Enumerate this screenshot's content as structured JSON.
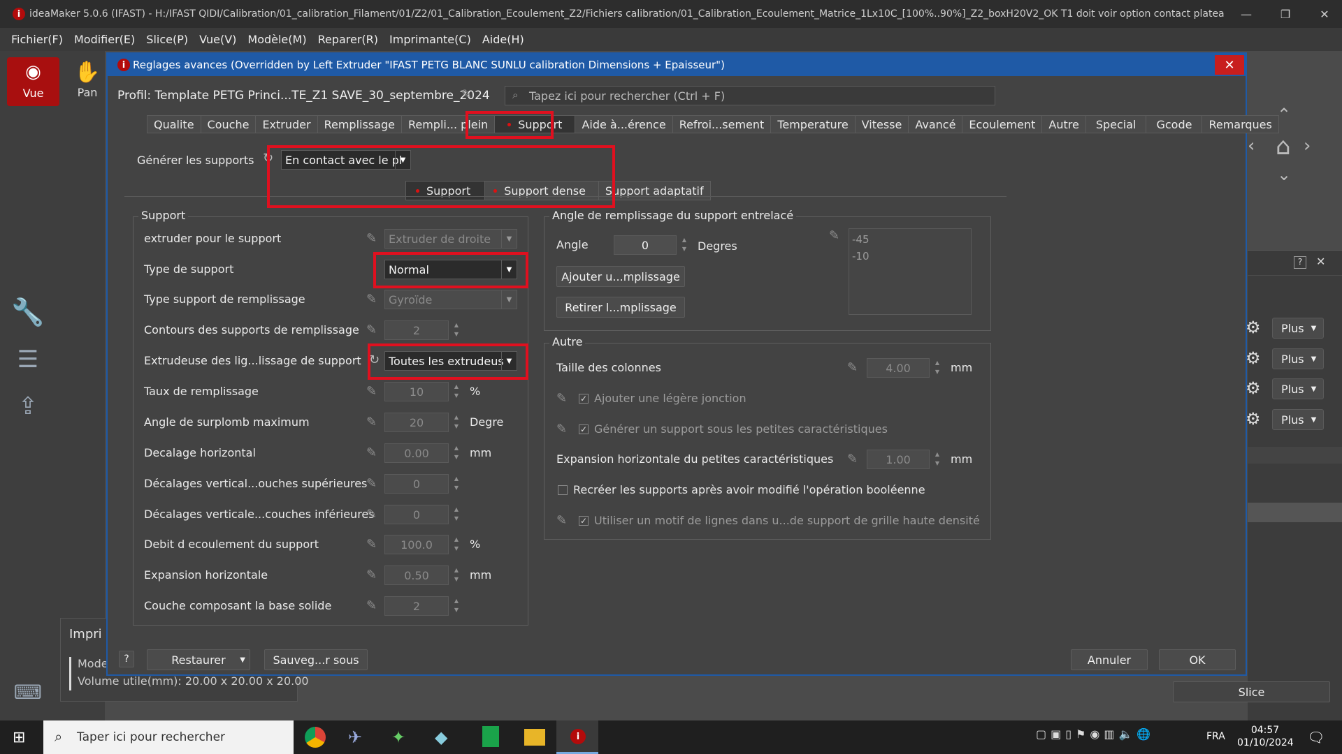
{
  "window": {
    "title": "ideaMaker 5.0.6 (IFAST) - H:/IFAST QIDI/Calibration/01_calibration_Filament/01/Z2/01_Calibration_Ecoulement_Z2/Fichiers calibration/01_Calibration_Ecoulement_Matrice_1Lx10C_[100%..90%]_Z2_boxH20V2_OK T1 doit voir option contact plateau.idea *"
  },
  "menu": [
    "Fichier(F)",
    "Modifier(E)",
    "Slice(P)",
    "Vue(V)",
    "Modèle(M)",
    "Reparer(R)",
    "Imprimante(C)",
    "Aide(H)"
  ],
  "toolbar": {
    "vue": "Vue",
    "pan": "Pan"
  },
  "printer_panel": {
    "title": "Impri",
    "model_label": "Mode",
    "volume": "Volume utile(mm): 20.00 x 20.00 x 20.00"
  },
  "right_panel": {
    "more_label": "Plus",
    "slice": "Slice"
  },
  "dialog": {
    "title": "Reglages avances (Overridden by Left Extruder \"IFAST PETG BLANC SUNLU calibration Dimensions + Epaisseur\")",
    "profile": "Profil: Template PETG Princi...TE_Z1 SAVE_30_septembre_2024",
    "search_placeholder": "Tapez ici pour rechercher (Ctrl + F)",
    "tabs": [
      "Qualite",
      "Couche",
      "Extruder",
      "Remplissage",
      "Rempli... plein",
      "Support",
      "Aide à...érence",
      "Refroi...sement",
      "Temperature",
      "Vitesse",
      "Avancé",
      "Ecoulement",
      "Autre",
      "Special",
      "Gcode",
      "Remarques"
    ],
    "generate_label": "Générer les supports",
    "generate_value": "En contact avec le pl",
    "subtabs": [
      "Support",
      "Support dense",
      "Support adaptatif"
    ],
    "support_group": {
      "title": "Support",
      "rows": [
        {
          "label": "extruder pour le support",
          "value": "Extruder de droite"
        },
        {
          "label": "Type de support",
          "value": "Normal"
        },
        {
          "label": "Type support de remplissage",
          "value": "Gyroïde"
        },
        {
          "label": "Contours des supports de remplissage",
          "value": "2"
        },
        {
          "label": "Extrudeuse des lig...lissage de support",
          "value": "Toutes les extrudeus"
        },
        {
          "label": "Taux de remplissage",
          "value": "10",
          "unit": "%"
        },
        {
          "label": "Angle de surplomb maximum",
          "value": "20",
          "unit": "Degre"
        },
        {
          "label": "Decalage horizontal",
          "value": "0.00",
          "unit": "mm"
        },
        {
          "label": "Décalages vertical...ouches supérieures",
          "value": "0"
        },
        {
          "label": "Décalages verticale...couches inférieures",
          "value": "0"
        },
        {
          "label": "Debit d ecoulement du support",
          "value": "100.0",
          "unit": "%"
        },
        {
          "label": "Expansion horizontale",
          "value": "0.50",
          "unit": "mm"
        },
        {
          "label": "Couche composant la base solide",
          "value": "2"
        }
      ]
    },
    "angle_group": {
      "title": "Angle de remplissage du support entrelacé",
      "angle_label": "Angle",
      "angle_value": "0",
      "angle_unit": "Degres",
      "add_btn": "Ajouter u...mplissage",
      "remove_btn": "Retirer l...mplissage",
      "list": [
        "-45",
        "-10"
      ]
    },
    "other_group": {
      "title": "Autre",
      "col_size_label": "Taille des colonnes",
      "col_size_value": "4.00",
      "col_size_unit": "mm",
      "light_join": "Ajouter une légère jonction",
      "small_features": "Générer un support sous les petites caractéristiques",
      "hexp_label": "Expansion horizontale du petites caractéristiques",
      "hexp_value": "1.00",
      "hexp_unit": "mm",
      "recreate": "Recréer les supports après avoir modifié l'opération booléenne",
      "lines_pattern": "Utiliser un motif de lignes dans u...de support de grille haute densité"
    },
    "footer": {
      "help": "?",
      "restore": "Restaurer",
      "save_as": "Sauveg...r sous",
      "cancel": "Annuler",
      "ok": "OK"
    }
  },
  "taskbar": {
    "search": "Taper ici pour rechercher",
    "lang": "FRA",
    "time": "04:57",
    "date": "01/10/2024"
  },
  "colors": {
    "accent": "#1f5aa6",
    "highlight": "#e0101f",
    "vue_active": "#a80f0f"
  }
}
